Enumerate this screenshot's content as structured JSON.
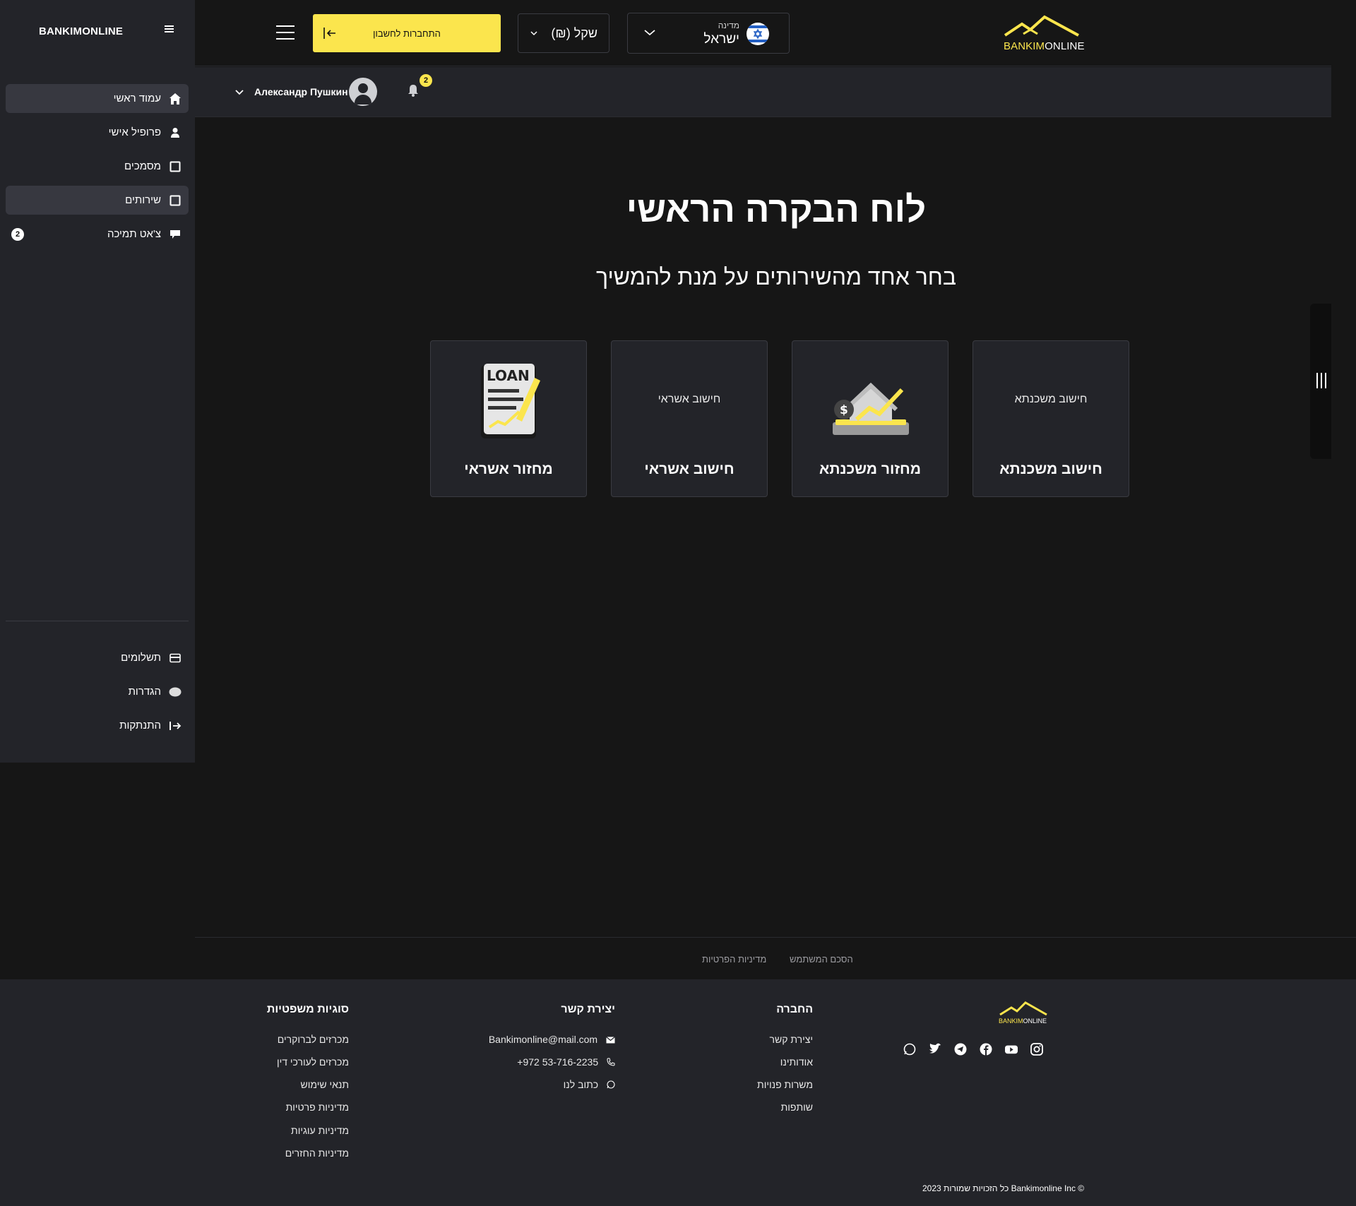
{
  "sidebar": {
    "title": "BANKIMONLINE",
    "items": [
      {
        "label": "עמוד ראשי",
        "icon": "home-icon"
      },
      {
        "label": "פרופיל אישי",
        "icon": "user-icon"
      },
      {
        "label": "מסמכים",
        "icon": "document-icon"
      },
      {
        "label": "שירותים",
        "icon": "services-icon"
      },
      {
        "label": "צ'אט תמיכה",
        "icon": "chat-icon",
        "badge": "2"
      }
    ],
    "bottom_items": [
      {
        "label": "תשלומים",
        "icon": "credit-card-icon"
      },
      {
        "label": "הגדרות",
        "icon": "settings-icon"
      },
      {
        "label": "התנתקות",
        "icon": "logout-icon"
      }
    ]
  },
  "header": {
    "login_label": "התחברות לחשבון",
    "currency": "(₪) שקל",
    "country_label": "מדינה",
    "country_value": "ישראל",
    "logo": {
      "part1": "BANKIM",
      "part2": "ONLINE"
    }
  },
  "userbar": {
    "user_name": "Александр Пушкин",
    "notifications_count": "2"
  },
  "main": {
    "title": "לוח הבקרה הראשי",
    "subtitle": "בחר אחד מהשירותים על מנת להמשיך",
    "cards": [
      {
        "label": "מחזור אשראי",
        "image": "loan-document"
      },
      {
        "label": "חישוב אשראי",
        "image_alt": "חישוב אשראי"
      },
      {
        "label": "מחזור משכנתא",
        "image": "house-refinance"
      },
      {
        "label": "חישוב משכנתא",
        "image_alt": "חישוב משכנתא"
      }
    ]
  },
  "legal": {
    "terms": "הסכם המשתמש",
    "privacy": "מדיניות הפרטיות"
  },
  "footer": {
    "logo": {
      "part1": "BANKIM",
      "part2": "ONLINE"
    },
    "company": {
      "title": "החברה",
      "links": [
        "יצירת קשר",
        "אודותינו",
        "משרות פנויות",
        "שותפות"
      ]
    },
    "contact": {
      "title": "יצירת קשר",
      "email": "Bankimonline@mail.com",
      "phone": "+972 53-716-2235",
      "write": "כתוב לנו"
    },
    "legal": {
      "title": "סוגיות משפטיות",
      "links": [
        "מכרזים לברוקרים",
        "מכרזים לעורכי דין",
        "תנאי שימוש",
        "מדיניות פרטיות",
        "מדיניות עוגיות",
        "מדיניות החזרים"
      ]
    },
    "social": [
      "instagram-icon",
      "youtube-icon",
      "facebook-icon",
      "telegram-icon",
      "twitter-icon",
      "whatsapp-icon"
    ],
    "copyright": "2023 כל הזכויות שמורות Bankimonline Inc ©"
  },
  "colors": {
    "accent": "#fbe54d",
    "sidebar": "#232429",
    "background": "#161616"
  }
}
